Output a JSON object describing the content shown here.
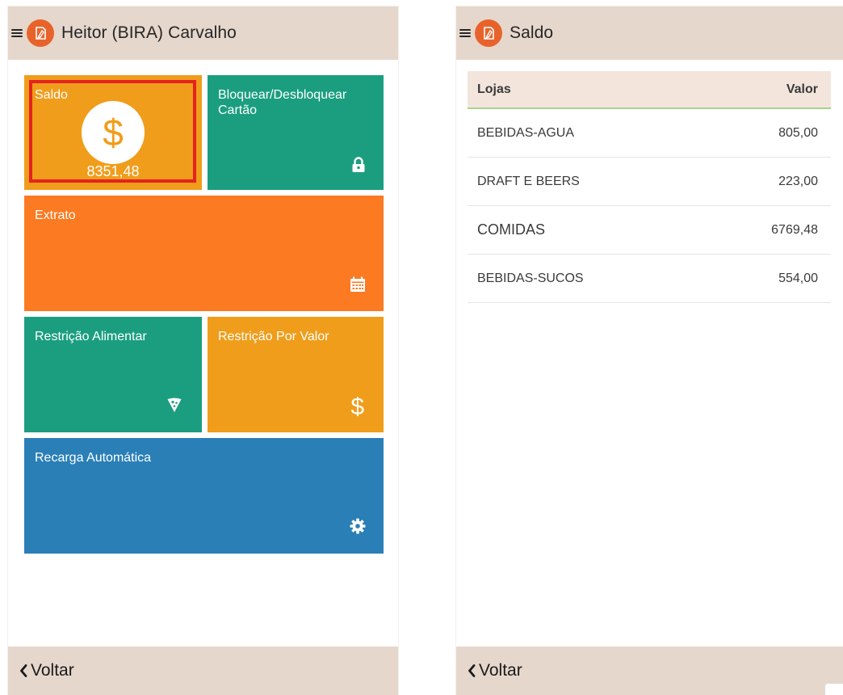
{
  "left_screen": {
    "header": {
      "title": "Heitor (BIRA) Carvalho"
    },
    "tiles": {
      "saldo": {
        "label": "Saldo",
        "value": "8351,48"
      },
      "bloquear": {
        "label": "Bloquear/Desbloquear Cartão"
      },
      "extrato": {
        "label": "Extrato"
      },
      "restricao_alimentar": {
        "label": "Restrição Alimentar"
      },
      "restricao_valor": {
        "label": "Restrição Por Valor",
        "icon_glyph": "$"
      },
      "recarga": {
        "label": "Recarga Automática"
      }
    },
    "footer": {
      "back_label": "Voltar"
    }
  },
  "right_screen": {
    "header": {
      "title": "Saldo"
    },
    "table": {
      "columns": [
        "Lojas",
        "Valor"
      ],
      "rows": [
        {
          "loja": "BEBIDAS-AGUA",
          "valor": "805,00"
        },
        {
          "loja": "DRAFT E BEERS",
          "valor": "223,00"
        },
        {
          "loja": "COMIDAS",
          "valor": "6769,48"
        },
        {
          "loja": "BEBIDAS-SUCOS",
          "valor": "554,00"
        }
      ]
    },
    "footer": {
      "back_label": "Voltar"
    }
  },
  "colors": {
    "header_bg": "#e6d7cc",
    "orange_tile": "#f09d1b",
    "teal_tile": "#1b9e80",
    "deep_orange_tile": "#fb7a22",
    "blue_tile": "#2a7fb7",
    "logo": "#e8632b",
    "highlight": "#e3231f"
  },
  "icons": {
    "menu": "menu-icon",
    "logo": "logo-icon",
    "saldo": "dollar-icon",
    "bloquear": "lock-icon",
    "extrato": "calendar-icon",
    "restricao_alimentar": "pizza-icon",
    "restricao_valor": "dollar-icon",
    "recarga": "gear-icon",
    "back": "chevron-left-icon"
  }
}
